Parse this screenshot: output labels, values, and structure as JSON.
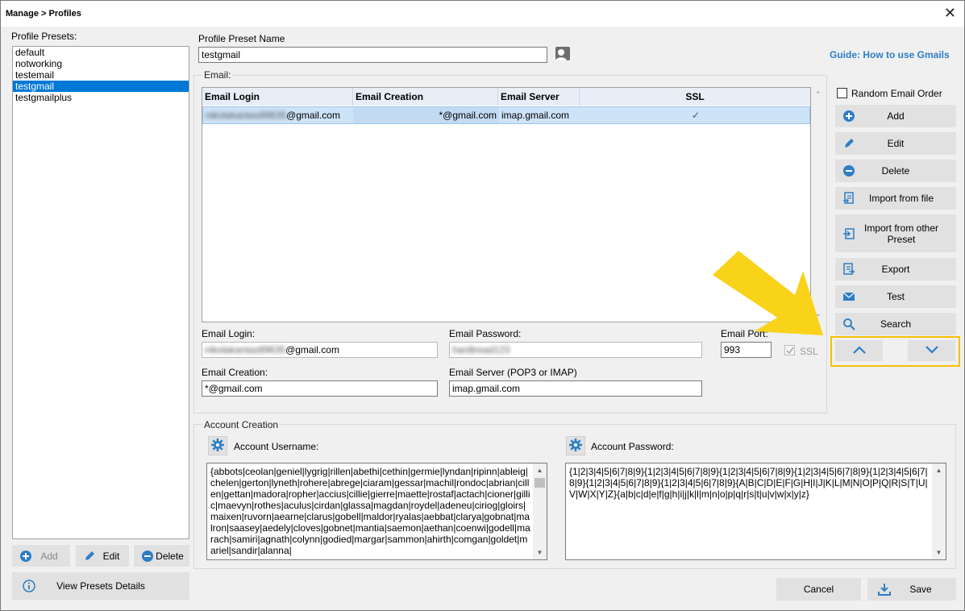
{
  "window": {
    "title": "Manage > Profiles",
    "close_glyph": "✕"
  },
  "presets": {
    "label": "Profile Presets:",
    "items": [
      "default",
      "notworking",
      "testemail",
      "testgmail",
      "testgmailplus"
    ],
    "selected_index": 3,
    "buttons": {
      "add": "Add",
      "edit": "Edit",
      "delete": "Delete"
    },
    "details_button": "View Presets Details"
  },
  "preset_name": {
    "label": "Profile Preset Name",
    "value": "testgmail"
  },
  "guide_link": "Guide: How to use Gmails",
  "email_group": {
    "label": "Email:",
    "columns": [
      "Email Login",
      "Email Creation",
      "Email Server",
      "SSL"
    ],
    "rows": [
      {
        "login_hidden": "nikolakantas89635",
        "login_suffix": "@gmail.com",
        "creation": "*@gmail.com",
        "server": "imap.gmail.com",
        "ssl": "✓"
      }
    ],
    "fields": {
      "login_label": "Email Login:",
      "login_hidden": "nikolakantas89635",
      "login_suffix": "@gmail.com",
      "password_label": "Email Password:",
      "password_hidden": "hardtread123",
      "port_label": "Email Port:",
      "port_value": "993",
      "ssl_label": "SSL",
      "creation_label": "Email Creation:",
      "creation_value": "*@gmail.com",
      "server_label": "Email Server (POP3 or IMAP)",
      "server_value": "imap.gmail.com"
    }
  },
  "side_panel": {
    "random_order": "Random Email Order",
    "buttons": {
      "add": "Add",
      "edit": "Edit",
      "delete": "Delete",
      "import_file": "Import from file",
      "import_preset": "Import from other Preset",
      "export": "Export",
      "test": "Test",
      "search": "Search"
    }
  },
  "account_creation": {
    "label": "Account Creation",
    "username_label": "Account Username:",
    "username_value": "{abbots|ceolan|geniel|lygrig|rillen|abethi|cethin|germie|lyndan|ripinn|ableig|chelen|gerton|lyneth|rohere|abrege|ciaram|gessar|machil|rondoc|abrian|cillen|gettan|madora|ropher|accius|cillie|gierre|maette|rostaf|actach|cioner|gillic|maevyn|rothes|aculus|cirdan|glassa|magdan|roydel|adeneu|ciriog|gloirs|maixen|ruvorn|aearne|clarus|gobell|maldor|ryalas|aebbat|clarya|gobnat|malron|saasey|aedely|cloves|gobnet|mantia|saemon|aethan|coenwi|godell|marach|samiri|agnath|colynn|godied|margar|sammon|ahirth|comgan|goldet|mariel|sandir|alanna|",
    "password_label": "Account Password:",
    "password_value": "{1|2|3|4|5|6|7|8|9}{1|2|3|4|5|6|7|8|9}{1|2|3|4|5|6|7|8|9}{1|2|3|4|5|6|7|8|9}{1|2|3|4|5|6|7|8|9}{1|2|3|4|5|6|7|8|9}{1|2|3|4|5|6|7|8|9}{A|B|C|D|E|F|G|H|I|J|K|L|M|N|O|P|Q|R|S|T|U|V|W|X|Y|Z}{a|b|c|d|e|f|g|h|i|j|k|l|m|n|o|p|q|r|s|t|u|v|w|x|y|z}"
  },
  "footer": {
    "cancel": "Cancel",
    "save": "Save"
  },
  "colors": {
    "accent": "#0078d7",
    "icon_blue": "#2d7ec4",
    "highlight": "#f6c000",
    "button_bg": "#e1e1e1"
  },
  "icons": [
    "close-icon",
    "user-card-icon",
    "plus-circle-icon",
    "pencil-icon",
    "minus-circle-icon",
    "import-file-icon",
    "import-preset-icon",
    "export-icon",
    "mail-icon",
    "search-icon",
    "chevron-up-icon",
    "chevron-down-icon",
    "gear-icon",
    "info-icon",
    "download-icon"
  ]
}
